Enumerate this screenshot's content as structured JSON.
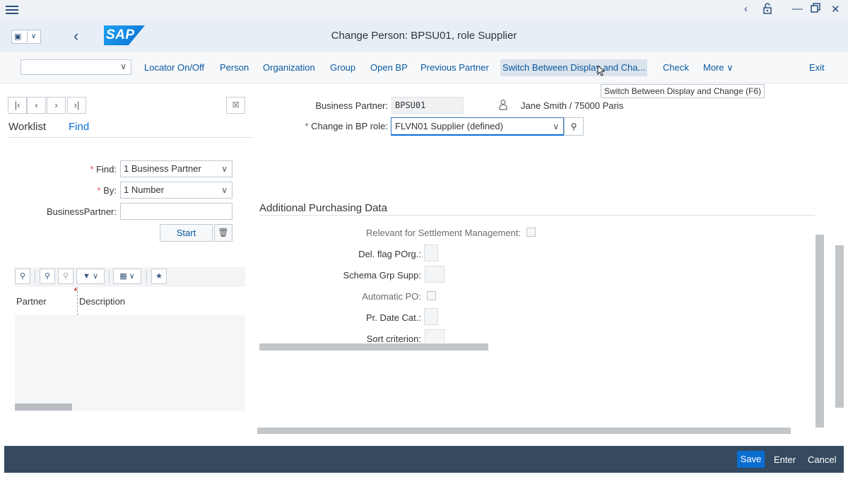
{
  "window": {
    "menu_icon": "hamburger-icon",
    "controls": [
      "‹",
      "⎘",
      "—",
      "❐",
      "✕"
    ]
  },
  "shell": {
    "title": "Change Person: BPSU01, role Supplier",
    "logo": "SAP"
  },
  "toolbar": {
    "buttons": {
      "locator": "Locator On/Off",
      "person": "Person",
      "organization": "Organization",
      "group": "Group",
      "open_bp": "Open BP",
      "previous_partner": "Previous Partner",
      "switch": "Switch Between Display and Cha...",
      "check": "Check",
      "more": "More",
      "exit": "Exit"
    },
    "tooltip": "Switch Between Display and Change   (F6)"
  },
  "left": {
    "tabs": {
      "worklist": "Worklist",
      "find": "Find"
    },
    "find_label": "Find:",
    "find_value": "1 Business Partner",
    "by_label": "By:",
    "by_value": "1 Number",
    "bp_label": "BusinessPartner:",
    "bp_value": "",
    "start": "Start",
    "columns": {
      "partner": "Partner",
      "description": "Description"
    }
  },
  "header": {
    "bp_label": "Business Partner:",
    "bp_value": "BPSU01",
    "person_text": "Jane Smith / 75000 Paris",
    "role_label": "Change in BP role:",
    "role_value": "FLVN01 Supplier (defined)"
  },
  "section": {
    "title": "Additional Purchasing Data",
    "fields": {
      "settlement": "Relevant for Settlement Management:",
      "del_flag": "Del. flag POrg.:",
      "schema": "Schema Grp Supp:",
      "auto_po": "Automatic PO:",
      "pr_date": "Pr. Date Cat.:",
      "sort": "Sort criterion:"
    }
  },
  "footer": {
    "save": "Save",
    "enter": "Enter",
    "cancel": "Cancel"
  }
}
